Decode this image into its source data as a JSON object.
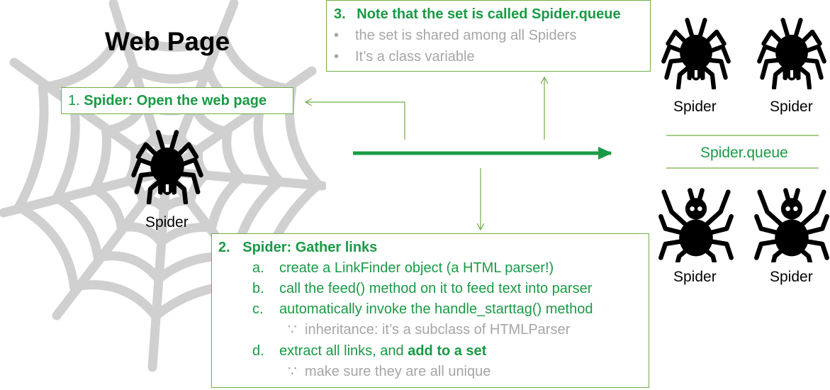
{
  "web_page": {
    "title": "Web Page",
    "spider_label": "Spider"
  },
  "step1": {
    "number": "1.",
    "text": "Spider: Open the web page"
  },
  "step2": {
    "number": "2.",
    "title": "Spider: Gather links",
    "items": [
      {
        "marker": "a.",
        "text": "create a LinkFinder object (a HTML parser!)"
      },
      {
        "marker": "b.",
        "text": "call the feed() method on it to feed text into parser"
      },
      {
        "marker": "c.",
        "text": "automatically invoke the handle_starttag() method"
      },
      {
        "marker": "∵",
        "text": "inheritance: it’s a subclass of HTMLParser"
      },
      {
        "marker": "d.",
        "text": "extract all links, and ",
        "bold": "add to a set"
      },
      {
        "marker": "∵",
        "text": "make sure they are all unique"
      }
    ]
  },
  "step3": {
    "number": "3.",
    "title": "Note that the set is called Spider.queue",
    "bullets": [
      "the set is shared among all Spiders",
      "It’s a class variable"
    ]
  },
  "queue": {
    "label": "Spider.queue",
    "spiders": [
      "Spider",
      "Spider",
      "Spider",
      "Spider"
    ]
  },
  "colors": {
    "accent": "#1a9a45",
    "border": "#70ad47",
    "muted": "#a6a6a6",
    "web": "#d0d0d0"
  },
  "icons": [
    "spider-web-icon",
    "spider-icon",
    "arrow-right-icon"
  ]
}
